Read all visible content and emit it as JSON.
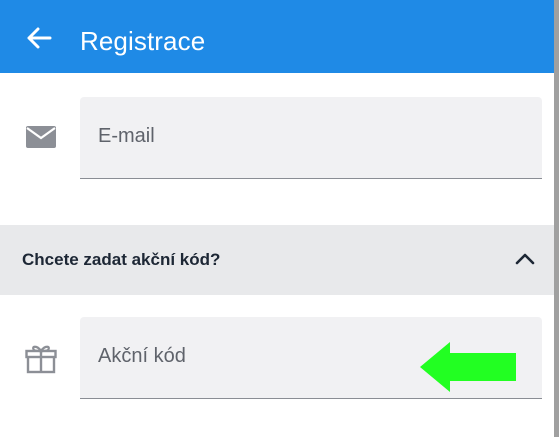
{
  "app_bar": {
    "title": "Registrace",
    "back_icon": "arrow-left-icon",
    "color": "#1f8ae6"
  },
  "form": {
    "email": {
      "icon": "mail-icon",
      "placeholder": "E-mail",
      "value": ""
    },
    "promo_section": {
      "label": "Chcete zadat akční kód?",
      "expanded": true,
      "chevron_icon": "chevron-up-icon"
    },
    "promo_code": {
      "icon": "gift-icon",
      "placeholder": "Akční kód",
      "value": ""
    }
  },
  "annotation": {
    "icon": "green-arrow-left-icon",
    "color": "#22ff22"
  }
}
